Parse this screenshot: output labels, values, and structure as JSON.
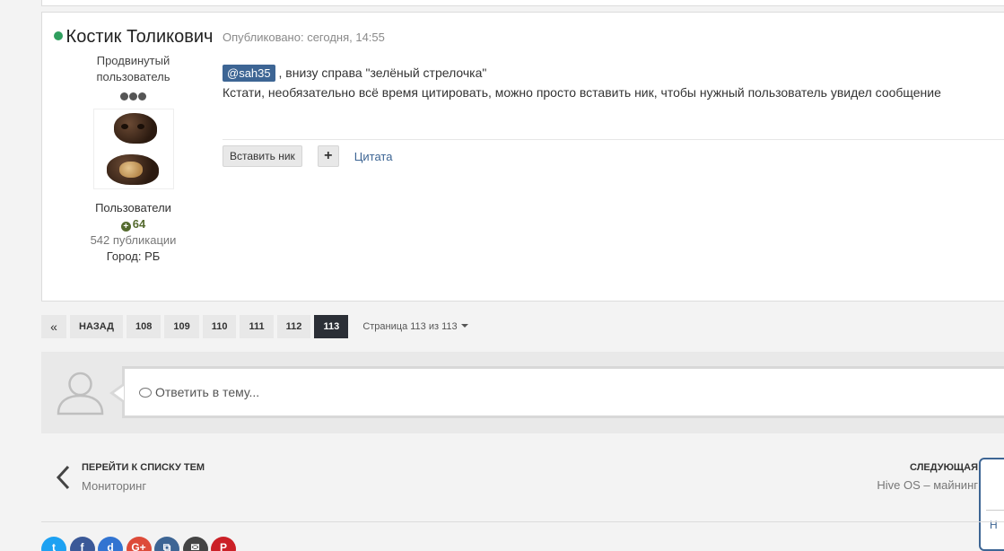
{
  "post": {
    "author": {
      "name": "Костик Толикович",
      "rank": "Продвинутый пользователь",
      "group": "Пользователи",
      "reputation": "64",
      "posts": "542 публикации",
      "city": "Город: РБ"
    },
    "date": "Опубликовано: сегодня, 14:55",
    "mention": "@sah35",
    "line1_rest": " , внизу справа \"зелёный стрелочка\"",
    "line2": "Кстати, необязательно всё время цитировать, можно просто вставить ник, чтобы нужный пользователь увидел сообщение",
    "actions": {
      "insert_nick": "Вставить ник",
      "plus": "+",
      "quote": "Цитата"
    }
  },
  "pagination": {
    "first": "«",
    "prev": "НАЗАД",
    "pages": [
      "108",
      "109",
      "110",
      "111",
      "112"
    ],
    "current": "113",
    "jump": "Страница 113 из 113"
  },
  "reply": {
    "placeholder": "Ответить в тему..."
  },
  "nav": {
    "prev_title": "ПЕРЕЙТИ К СПИСКУ ТЕМ",
    "prev_sub": "Мониторинг",
    "next_title": "СЛЕДУЮЩАЯ",
    "next_sub": "Hive OS – майнинг",
    "popup_letter": "Н"
  },
  "share": [
    {
      "icon": "twitter-icon",
      "color": "#1da1f2"
    },
    {
      "icon": "facebook-icon",
      "color": "#3b5998"
    },
    {
      "icon": "delicious-icon",
      "color": "#3274d1"
    },
    {
      "icon": "google-plus-icon",
      "color": "#dd4b39"
    },
    {
      "icon": "share-icon",
      "color": "#3d6594"
    },
    {
      "icon": "email-icon",
      "color": "#444444"
    },
    {
      "icon": "pinterest-icon",
      "color": "#cb2027"
    }
  ],
  "colors": {
    "online": "#2f9e5e",
    "mention_bg": "#3d6594",
    "active_page": "#2b2f36",
    "reputation": "#556b2f"
  }
}
